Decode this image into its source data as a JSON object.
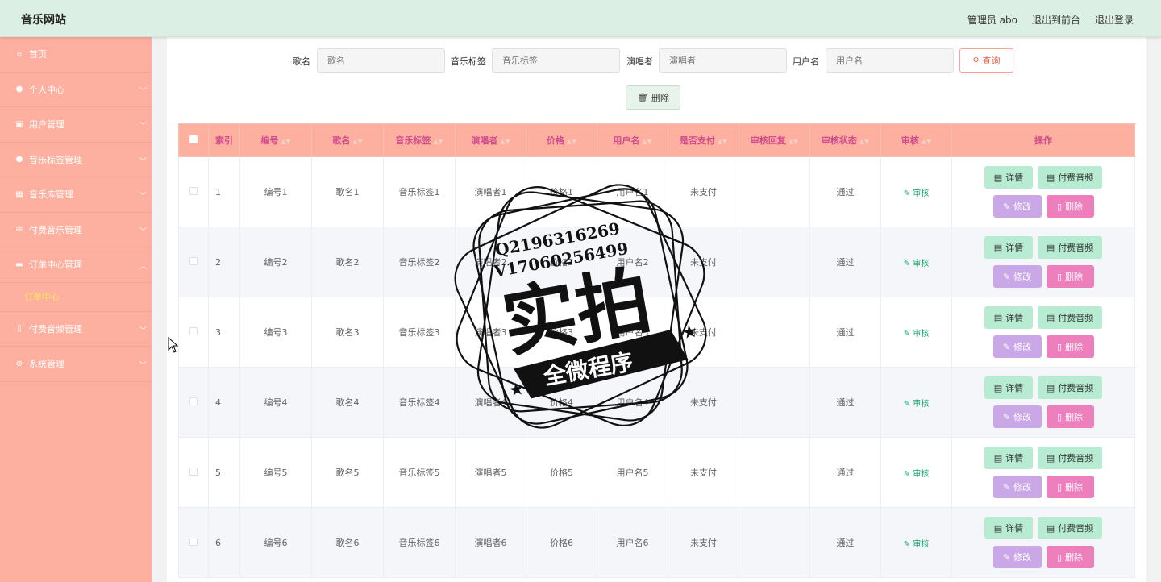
{
  "brand": "音乐网站",
  "topnav": {
    "admin": "管理员 abo",
    "front": "退出到前台",
    "logout": "退出登录"
  },
  "sidebar": [
    {
      "label": "首页",
      "icon": "home-icon",
      "glyph": "⌂",
      "chevron": false
    },
    {
      "label": "个人中心",
      "icon": "user-icon",
      "glyph": "●",
      "chevron": true
    },
    {
      "label": "用户管理",
      "icon": "user-manage-icon",
      "glyph": "▣",
      "chevron": true
    },
    {
      "label": "音乐标签管理",
      "icon": "user-icon",
      "glyph": "●",
      "chevron": true
    },
    {
      "label": "音乐库管理",
      "icon": "grid-icon",
      "glyph": "▦",
      "chevron": true
    },
    {
      "label": "付费音乐管理",
      "icon": "mail-icon",
      "glyph": "✉",
      "chevron": true
    },
    {
      "label": "订单中心管理",
      "icon": "chat-icon",
      "glyph": "▬",
      "chevron": true,
      "open": true
    },
    {
      "label": "付费音频管理",
      "icon": "mic-icon",
      "glyph": "▯",
      "chevron": true
    },
    {
      "label": "系统管理",
      "icon": "settings-icon",
      "glyph": "⊘",
      "chevron": true
    }
  ],
  "submenu": {
    "label": "订单中心"
  },
  "search": {
    "song_label": "歌名",
    "song_placeholder": "歌名",
    "tag_label": "音乐标签",
    "tag_placeholder": "音乐标签",
    "singer_label": "演唱者",
    "singer_placeholder": "演唱者",
    "user_label": "用户名",
    "user_placeholder": "用户名",
    "query_button": "查询"
  },
  "delete_button": "删除",
  "table": {
    "headers": [
      "索引",
      "编号",
      "歌名",
      "音乐标签",
      "演唱者",
      "价格",
      "用户名",
      "是否支付",
      "审核回复",
      "审核状态",
      "审核",
      "操作"
    ],
    "audit_label": "审核",
    "op_detail": "详情",
    "op_pay": "付费音频",
    "op_edit": "修改",
    "op_delete": "删除",
    "rows": [
      {
        "idx": "1",
        "no": "编号1",
        "song": "歌名1",
        "tag": "音乐标签1",
        "singer": "演唱者1",
        "price": "价格1",
        "user": "用户名1",
        "paid": "未支付",
        "reply": "",
        "status": "通过"
      },
      {
        "idx": "2",
        "no": "编号2",
        "song": "歌名2",
        "tag": "音乐标签2",
        "singer": "演唱者2",
        "price": "价格2",
        "user": "用户名2",
        "paid": "未支付",
        "reply": "",
        "status": "通过"
      },
      {
        "idx": "3",
        "no": "编号3",
        "song": "歌名3",
        "tag": "音乐标签3",
        "singer": "演唱者3",
        "price": "价格3",
        "user": "用户名3",
        "paid": "未支付",
        "reply": "",
        "status": "通过"
      },
      {
        "idx": "4",
        "no": "编号4",
        "song": "歌名4",
        "tag": "音乐标签4",
        "singer": "演唱者4",
        "price": "价格4",
        "user": "用户名4",
        "paid": "未支付",
        "reply": "",
        "status": "通过"
      },
      {
        "idx": "5",
        "no": "编号5",
        "song": "歌名5",
        "tag": "音乐标签5",
        "singer": "演唱者5",
        "price": "价格5",
        "user": "用户名5",
        "paid": "未支付",
        "reply": "",
        "status": "通过"
      },
      {
        "idx": "6",
        "no": "编号6",
        "song": "歌名6",
        "tag": "音乐标签6",
        "singer": "演唱者6",
        "price": "价格6",
        "user": "用户名6",
        "paid": "未支付",
        "reply": "",
        "status": "通过"
      }
    ]
  },
  "watermark": {
    "line1": "Q2196316269",
    "line2": "V17060256499",
    "big": "实拍",
    "ribbon": "全微程序"
  }
}
